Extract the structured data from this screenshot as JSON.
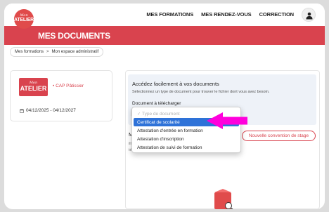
{
  "nav": {
    "logo": {
      "small": "Mon",
      "big": "ATELIER"
    },
    "links": [
      "MES FORMATIONS",
      "MES RENDEZ-VOUS",
      "CORRECTION"
    ],
    "user_icon": "user-icon"
  },
  "banner": {
    "title": "MES DOCUMENTS"
  },
  "breadcrumb": {
    "items": [
      "Mes formations",
      "Mon espace administratif"
    ],
    "separator": ">"
  },
  "course_card": {
    "logo": {
      "small": "Mon",
      "big": "ATELIER"
    },
    "course": "• CAP Pâtissier",
    "dates": "04/12/2025 - 04/12/2027",
    "calendar_icon": "calendar-icon"
  },
  "documents": {
    "title": "Accédez facilement à vos documents",
    "description": "Sélectionnez un type de document pour trouver le fichier dont vous avez besoin.",
    "select_label": "Document à télécharger",
    "dropdown": {
      "options": [
        "Type de document",
        "Certificat de scolarité",
        "Attestation d'entrée en formation",
        "Attestation d'inscription",
        "Attestation de suivi de formation"
      ],
      "selected_index": 1
    }
  },
  "conventions": {
    "title_partial": "M",
    "line1_partial": "ill",
    "line2_partial": "tél",
    "new_button": "Nouvelle convention de stage"
  },
  "colors": {
    "brand_red": "#d9434e",
    "selection_blue": "#2e72d8",
    "arrow_magenta": "#ff00dc"
  }
}
